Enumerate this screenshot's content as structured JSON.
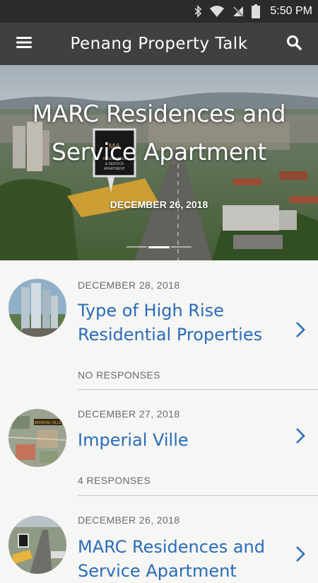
{
  "status_bar": {
    "time": "5:50 PM",
    "icons": [
      "bluetooth-icon",
      "wifi-icon",
      "no-signal-icon",
      "battery-icon"
    ]
  },
  "app_bar": {
    "title": "Penang Property Talk",
    "menu_icon": "hamburger-menu-icon",
    "search_icon": "search-icon"
  },
  "hero": {
    "title": "MARC Residences and Service Apartment",
    "date": "DECEMBER 26, 2018",
    "sign_text": [
      "RESIDENCES",
      "& SERVICE",
      "APARTMENT"
    ],
    "slide_count": 3,
    "active_slide": 2
  },
  "posts": [
    {
      "date": "DECEMBER 28, 2018",
      "title": "Type of High Rise Residential Properties",
      "responses": "NO RESPONSES"
    },
    {
      "date": "DECEMBER 27, 2018",
      "title": "Imperial Ville",
      "responses": "4 RESPONSES",
      "thumb_label": "IMPERIAL VILLE"
    },
    {
      "date": "DECEMBER 26, 2018",
      "title": "MARC Residences and Service Apartment"
    }
  ],
  "colors": {
    "status_bar": "#2b2b2b",
    "app_bar": "#404040",
    "link": "#2a6cb8",
    "meta_text": "#6a6a6a"
  }
}
